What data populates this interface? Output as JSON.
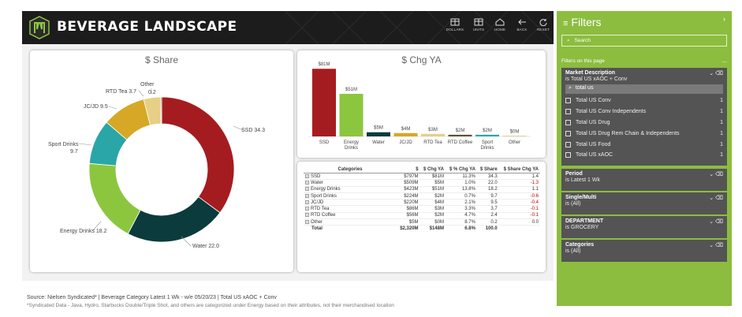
{
  "header": {
    "title": "BEVERAGE LANDSCAPE",
    "buttons": [
      {
        "label": "DOLLARS",
        "icon": "dollar-table-icon"
      },
      {
        "label": "UNITS",
        "icon": "units-table-icon"
      },
      {
        "label": "HOME",
        "icon": "home-icon"
      },
      {
        "label": "BACK",
        "icon": "back-arrow-icon"
      },
      {
        "label": "RESET",
        "icon": "reset-icon"
      }
    ]
  },
  "share_chart": {
    "title": "$ Share",
    "chart_data": {
      "type": "pie",
      "title": "$ Share",
      "categories": [
        "SSD",
        "Water",
        "Energy Drinks",
        "Sport Drinks",
        "JC/JD",
        "RTD Tea",
        "Other"
      ],
      "values": [
        34.3,
        22.0,
        18.2,
        9.7,
        9.5,
        3.7,
        0.2
      ],
      "labels": [
        "SSD 34.3",
        "Water 22.0",
        "Energy Drinks 18.2",
        "Sport Drinks",
        "9.7",
        "JC/JD 9.5",
        "RTD Tea 3.7",
        "Other",
        "0.2"
      ],
      "colors": [
        "#a51c20",
        "#0b3b3c",
        "#8cc63f",
        "#2aa6a8",
        "#d6a826",
        "#e8cf86",
        "#5f5130",
        "#c9b458"
      ]
    }
  },
  "chg_chart": {
    "title": "$ Chg YA",
    "chart_data": {
      "type": "bar",
      "title": "$ Chg YA",
      "categories": [
        "SSD",
        "Energy Drinks",
        "Water",
        "JC/JD",
        "RTD Tea",
        "RTD Coffee",
        "Sport Drinks",
        "Other"
      ],
      "values": [
        81,
        51,
        5,
        4,
        3,
        2,
        2,
        0
      ],
      "data_labels": [
        "$81M",
        "$51M",
        "$5M",
        "$4M",
        "$3M",
        "$2M",
        "$2M",
        "$0M"
      ],
      "colors": [
        "#a51c20",
        "#8cc63f",
        "#0b3b3c",
        "#d6a826",
        "#e8cf86",
        "#5f5130",
        "#2aa6a8",
        "#c9b458"
      ],
      "ylim": [
        0,
        85
      ]
    }
  },
  "table": {
    "columns": [
      "Categories",
      "$",
      "$ Chg YA",
      "$ % Chg YA",
      "$ Share",
      "$ Share Chg YA"
    ],
    "rows": [
      {
        "cat": "SSD",
        "v1": "$797M",
        "v2": "$81M",
        "v3": "11.3%",
        "v4": "34.3",
        "v5": "1.4",
        "neg": false
      },
      {
        "cat": "Water",
        "v1": "$509M",
        "v2": "$5M",
        "v3": "1.0%",
        "v4": "22.0",
        "v5": "-1.3",
        "neg": true
      },
      {
        "cat": "Energy Drinks",
        "v1": "$423M",
        "v2": "$51M",
        "v3": "13.8%",
        "v4": "18.2",
        "v5": "1.1",
        "neg": false
      },
      {
        "cat": "Sport Drinks",
        "v1": "$224M",
        "v2": "$2M",
        "v3": "0.7%",
        "v4": "9.7",
        "v5": "-0.6",
        "neg": true
      },
      {
        "cat": "JC/JD",
        "v1": "$220M",
        "v2": "$4M",
        "v3": "2.1%",
        "v4": "9.5",
        "v5": "-0.4",
        "neg": true
      },
      {
        "cat": "RTD Tea",
        "v1": "$86M",
        "v2": "$3M",
        "v3": "3.3%",
        "v4": "3.7",
        "v5": "-0.1",
        "neg": true
      },
      {
        "cat": "RTD Coffee",
        "v1": "$56M",
        "v2": "$2M",
        "v3": "4.7%",
        "v4": "2.4",
        "v5": "-0.1",
        "neg": true
      },
      {
        "cat": "Other",
        "v1": "$5M",
        "v2": "$0M",
        "v3": "8.7%",
        "v4": "0.2",
        "v5": "0.0",
        "neg": false
      }
    ],
    "total": {
      "cat": "Total",
      "v1": "$2,320M",
      "v2": "$148M",
      "v3": "6.8%",
      "v4": "100.0",
      "v5": ""
    }
  },
  "source": {
    "line1": "Source: Nielsen Syndicated* | Beverage Category Latest 1 Wk - w/e 05/20/23 | Total US xAOC + Conv",
    "line2": "*Syndicated Data - Java, Hydro, Starbucks Double/Triple Shot, and others are categorized under Energy based on their attributes, not their merchandised location"
  },
  "filters": {
    "title": "Filters",
    "search_placeholder": "Search",
    "subheader": "Filters on this page",
    "more": "...",
    "market": {
      "title": "Market Description",
      "value": "is Total US xAOC + Conv",
      "search_text": "total us",
      "options": [
        {
          "label": "Total US Conv",
          "count": "1"
        },
        {
          "label": "Total US Conv Independents",
          "count": "1"
        },
        {
          "label": "Total US Drug",
          "count": "1"
        },
        {
          "label": "Total US Drug Rem Chain & Independents",
          "count": "1"
        },
        {
          "label": "Total US Food",
          "count": "1"
        },
        {
          "label": "Total US xAOC",
          "count": "1"
        }
      ]
    },
    "cards": [
      {
        "title": "Period",
        "value": "is Latest 1 Wk"
      },
      {
        "title": "Single/Multi",
        "value": "is (All)"
      },
      {
        "title": "DEPARTMENT",
        "value": "is GROCERY"
      },
      {
        "title": "Categories",
        "value": "is (All)"
      }
    ]
  }
}
